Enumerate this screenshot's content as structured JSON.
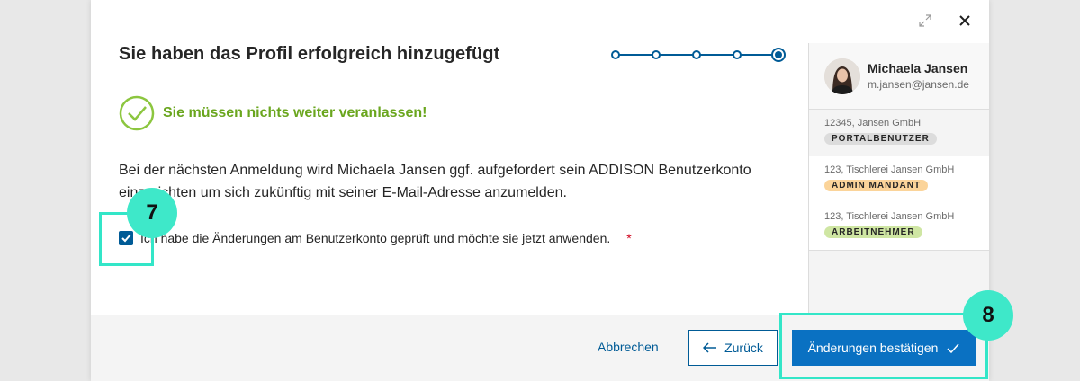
{
  "dialog": {
    "title": "Sie haben das Profil erfolgreich hinzugefügt",
    "success_message": "Sie müssen nichts weiter veranlassen!",
    "body_text": "Bei der nächsten Anmeldung wird Michaela Jansen ggf. aufgefordert sein ADDISON Benutzerkonto einzurichten um sich zukünftig mit seiner E-Mail-Adresse anzumelden.",
    "checkbox_label": "Ich habe die Änderungen am Benutzerkonto geprüft und möchte sie jetzt anwenden.",
    "checkbox_checked": true,
    "required_marker": "*"
  },
  "stepper": {
    "total_steps": 5,
    "current_step": 5,
    "color": "#005b96"
  },
  "window_controls": {
    "expand_icon": "expand-icon",
    "close_icon": "close-icon"
  },
  "sidebar": {
    "profile": {
      "name": "Michaela Jansen",
      "email": "m.jansen@jansen.de"
    },
    "items": [
      {
        "company": "12345, Jansen GmbH",
        "role": "PORTALBENUTZER",
        "role_color": "#dcdcdc"
      },
      {
        "company": "123, Tischlerei Jansen GmbH",
        "role": "ADMIN MANDANT",
        "role_color": "#fbd49a"
      },
      {
        "company": "123, Tischlerei Jansen GmbH",
        "role": "ARBEITNEHMER",
        "role_color": "#cfe6a3"
      }
    ]
  },
  "footer": {
    "cancel_label": "Abbrechen",
    "back_label": "Zurück",
    "confirm_label": "Änderungen bestätigen"
  },
  "annotations": [
    {
      "label": "7"
    },
    {
      "label": "8"
    }
  ],
  "colors": {
    "primary": "#005b96",
    "confirm": "#0a71c2",
    "success": "#6aa61e",
    "annotation": "#3ee8c9",
    "required": "#d0011b"
  }
}
